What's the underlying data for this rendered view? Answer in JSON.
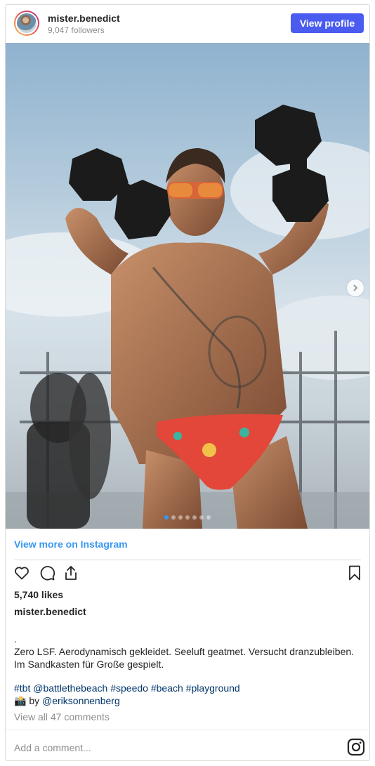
{
  "header": {
    "username": "mister.benedict",
    "followers": "9,047 followers",
    "view_profile_label": "View profile",
    "button_color": "#4a5bf0"
  },
  "media": {
    "carousel_total": 7,
    "carousel_active_index": 0,
    "next_icon": "chevron-right-icon"
  },
  "view_more_label": "View more on Instagram",
  "actions": {
    "like_icon": "heart-icon",
    "comment_icon": "comment-icon",
    "share_icon": "share-icon",
    "save_icon": "bookmark-icon"
  },
  "likes": "5,740 likes",
  "caption": {
    "username": "mister.benedict",
    "text": ".\nZero LSF. Aerodynamisch gekleidet. Seeluft geatmet. Versucht dranzubleiben. Im Sandkasten für Große gespielt.",
    "tags": [
      "#tbt",
      "@battlethebeach",
      "#speedo",
      "#beach",
      "#playground"
    ],
    "credit_emoji": "📸",
    "credit_by": "by",
    "credit_handle": "@eriksonnenberg"
  },
  "comments_label": "View all 47 comments",
  "add_comment_placeholder": "Add a comment...",
  "link_color": "#3897f0"
}
